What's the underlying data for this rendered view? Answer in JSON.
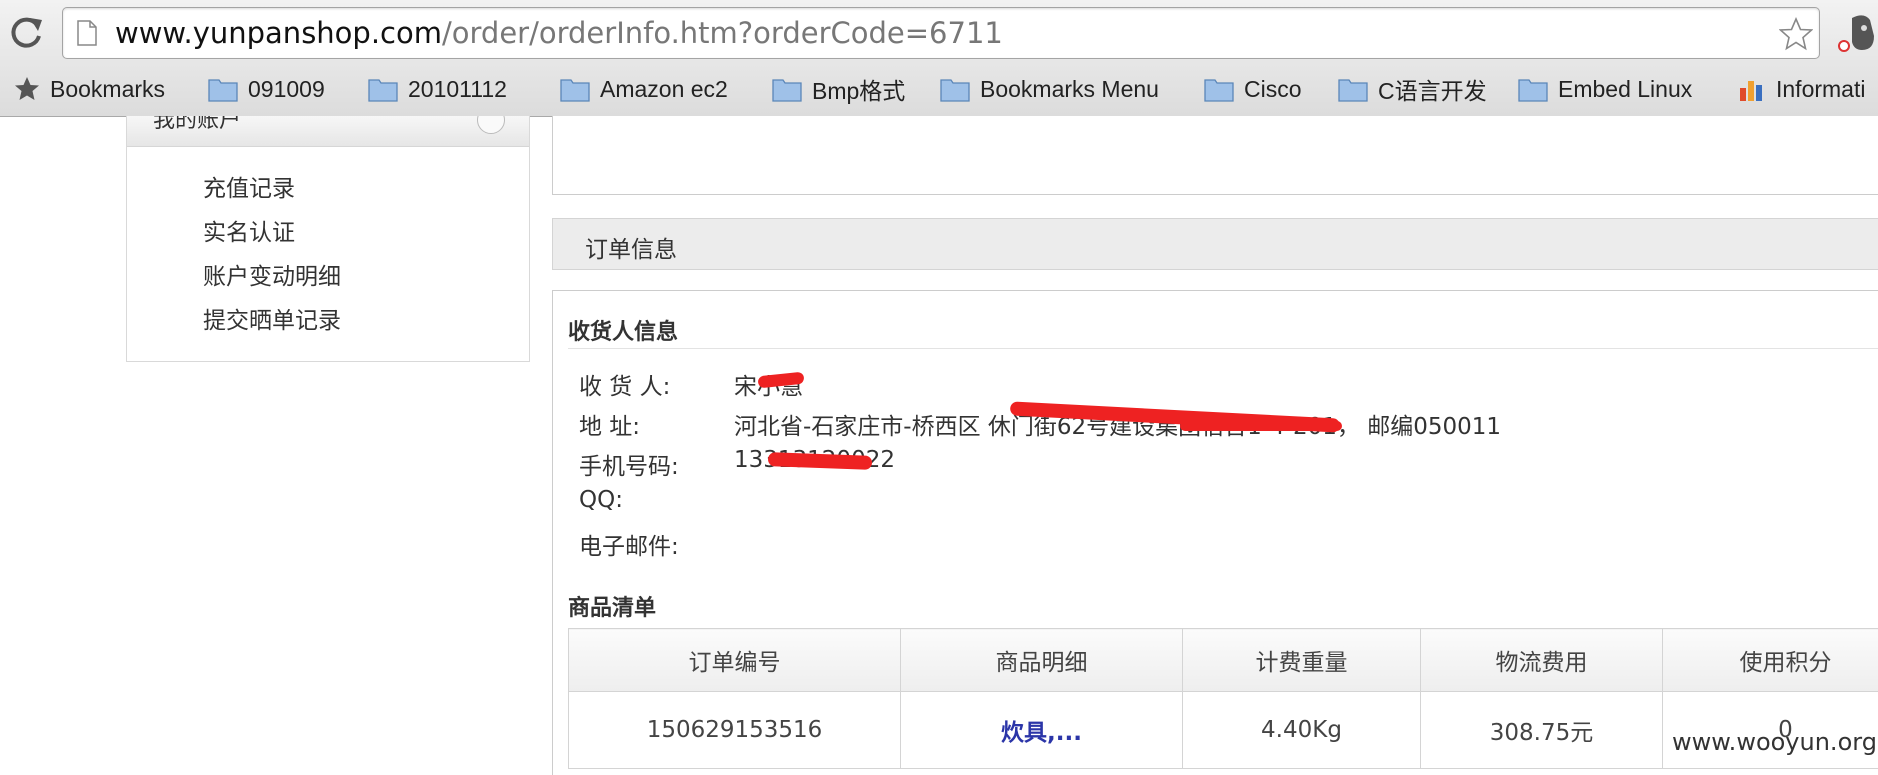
{
  "browser": {
    "url_host": "www.yunpanshop.com",
    "url_path": "/order/orderInfo.htm?orderCode=6711",
    "bookmarks": [
      {
        "label": "Bookmarks",
        "icon": "star-icon"
      },
      {
        "label": "091009",
        "icon": "folder-icon"
      },
      {
        "label": "20101112",
        "icon": "folder-icon"
      },
      {
        "label": "Amazon ec2",
        "icon": "folder-icon"
      },
      {
        "label": "Bmp格式",
        "icon": "folder-icon"
      },
      {
        "label": "Bookmarks Menu",
        "icon": "folder-icon"
      },
      {
        "label": "Cisco",
        "icon": "folder-icon"
      },
      {
        "label": "C语言开发",
        "icon": "folder-icon"
      },
      {
        "label": "Embed Linux",
        "icon": "folder-icon"
      },
      {
        "label": "Informati",
        "icon": "chart-icon"
      }
    ]
  },
  "sidebar": {
    "title": "我的账户",
    "links": [
      "充值记录",
      "实名认证",
      "账户变动明细",
      "提交晒单记录"
    ]
  },
  "order_section": {
    "title": "订单信息"
  },
  "recipient": {
    "heading": "收货人信息",
    "rows": [
      {
        "label": "收 货 人:",
        "value": "宋小慧"
      },
      {
        "label": "地      址:",
        "value": "河北省-石家庄市-桥西区 休门街62号建设集团宿舍1-4-201， 邮编050011"
      },
      {
        "label": "手机号码:",
        "value": "13313120022"
      },
      {
        "label": "QQ:",
        "value": ""
      },
      {
        "label": "电子邮件:",
        "value": ""
      }
    ]
  },
  "goods": {
    "heading": "商品清单",
    "columns": [
      "订单编号",
      "商品明细",
      "计费重量",
      "物流费用",
      "使用积分"
    ],
    "rows": [
      [
        "150629153516",
        "炊具,...",
        "4.40Kg",
        "308.75元",
        "0"
      ]
    ]
  },
  "watermark": "www.wooyun.org",
  "colors": {
    "link": "#2b35a8",
    "redaction": "#ee2222"
  }
}
